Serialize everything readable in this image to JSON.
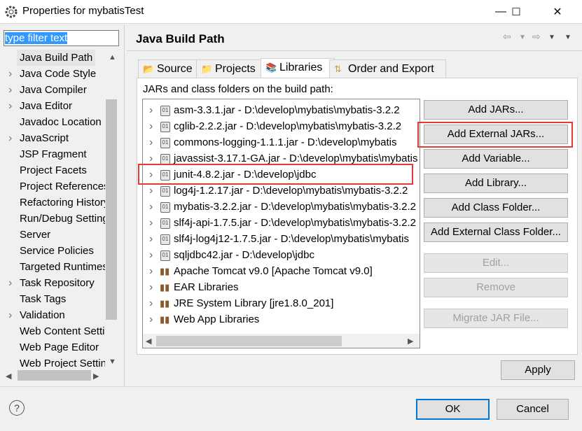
{
  "window": {
    "title": "Properties for mybatisTest",
    "minimize": "—",
    "maximize": "☐",
    "close": "✕"
  },
  "filter": {
    "value": "type filter text"
  },
  "left_tree": [
    {
      "label": "Java Build Path",
      "expand": false,
      "selected": true
    },
    {
      "label": "Java Code Style",
      "expand": true
    },
    {
      "label": "Java Compiler",
      "expand": true
    },
    {
      "label": "Java Editor",
      "expand": true
    },
    {
      "label": "Javadoc Location",
      "expand": false
    },
    {
      "label": "JavaScript",
      "expand": true
    },
    {
      "label": "JSP Fragment",
      "expand": false
    },
    {
      "label": "Project Facets",
      "expand": false
    },
    {
      "label": "Project References",
      "expand": false
    },
    {
      "label": "Refactoring History",
      "expand": false
    },
    {
      "label": "Run/Debug Settings",
      "expand": false
    },
    {
      "label": "Server",
      "expand": false
    },
    {
      "label": "Service Policies",
      "expand": false
    },
    {
      "label": "Targeted Runtimes",
      "expand": false
    },
    {
      "label": "Task Repository",
      "expand": true
    },
    {
      "label": "Task Tags",
      "expand": false
    },
    {
      "label": "Validation",
      "expand": true
    },
    {
      "label": "Web Content Settings",
      "expand": false
    },
    {
      "label": "Web Page Editor",
      "expand": false
    },
    {
      "label": "Web Project Settings",
      "expand": false
    }
  ],
  "page": {
    "title": "Java Build Path"
  },
  "tabs": [
    {
      "label": "Source",
      "icon": "source-icon"
    },
    {
      "label": "Projects",
      "icon": "projects-icon"
    },
    {
      "label": "Libraries",
      "icon": "libraries-icon",
      "active": true
    },
    {
      "label": "Order and Export",
      "icon": "order-export-icon"
    }
  ],
  "libraries": {
    "label": "JARs and class folders on the build path:",
    "items": [
      {
        "label": "asm-3.3.1.jar - D:\\develop\\mybatis\\mybatis-3.2.2",
        "type": "jar"
      },
      {
        "label": "cglib-2.2.2.jar - D:\\develop\\mybatis\\mybatis-3.2.2",
        "type": "jar"
      },
      {
        "label": "commons-logging-1.1.1.jar - D:\\develop\\mybatis",
        "type": "jar"
      },
      {
        "label": "javassist-3.17.1-GA.jar - D:\\develop\\mybatis\\mybatis",
        "type": "jar"
      },
      {
        "label": "junit-4.8.2.jar - D:\\develop\\jdbc",
        "type": "jar"
      },
      {
        "label": "log4j-1.2.17.jar - D:\\develop\\mybatis\\mybatis-3.2.2",
        "type": "jar"
      },
      {
        "label": "mybatis-3.2.2.jar - D:\\develop\\mybatis\\mybatis-3.2.2",
        "type": "jar"
      },
      {
        "label": "slf4j-api-1.7.5.jar - D:\\develop\\mybatis\\mybatis-3.2.2",
        "type": "jar"
      },
      {
        "label": "slf4j-log4j12-1.7.5.jar - D:\\develop\\mybatis\\mybatis",
        "type": "jar"
      },
      {
        "label": "sqljdbc42.jar - D:\\develop\\jdbc",
        "type": "jar"
      },
      {
        "label": "Apache Tomcat v9.0 [Apache Tomcat v9.0]",
        "type": "lib"
      },
      {
        "label": "EAR Libraries",
        "type": "lib"
      },
      {
        "label": "JRE System Library [jre1.8.0_201]",
        "type": "lib"
      },
      {
        "label": "Web App Libraries",
        "type": "lib"
      }
    ]
  },
  "buttons": {
    "add_jars": "Add JARs...",
    "add_external_jars": "Add External JARs...",
    "add_variable": "Add Variable...",
    "add_library": "Add Library...",
    "add_class_folder": "Add Class Folder...",
    "add_external_class_folder": "Add External Class Folder...",
    "edit": "Edit...",
    "remove": "Remove",
    "migrate": "Migrate JAR File...",
    "apply": "Apply",
    "ok": "OK",
    "cancel": "Cancel"
  },
  "help": "?",
  "colors": {
    "highlight": "#e53935",
    "selection": "#3399ff",
    "default_button_border": "#0078d7"
  }
}
